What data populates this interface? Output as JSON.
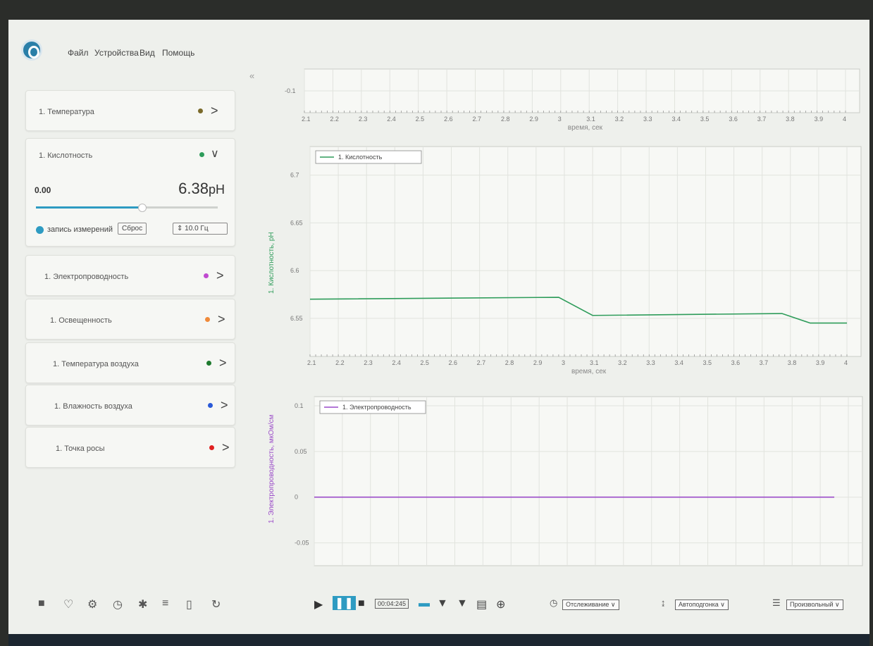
{
  "menu": [
    "Файл",
    "Устройства",
    "Вид",
    "Помощь"
  ],
  "collapse_glyph": "«",
  "sensors": [
    {
      "label": "1. Температура",
      "color": "#7a6a2a",
      "chevron": ">"
    },
    {
      "label": "1. Кислотность",
      "color": "#2e9c5a",
      "chevron": "∨"
    },
    {
      "label": "1. Электропроводность",
      "color": "#c04ad0",
      "chevron": ">"
    },
    {
      "label": "1. Освещенность",
      "color": "#f08a3a",
      "chevron": ">"
    },
    {
      "label": "1. Температура воздуха",
      "color": "#1e7a2e",
      "chevron": ">"
    },
    {
      "label": "1. Влажность воздуха",
      "color": "#2a5ad8",
      "chevron": ">"
    },
    {
      "label": "1. Точка росы",
      "color": "#e02020",
      "chevron": ">"
    }
  ],
  "expanded": {
    "min_value": "0.00",
    "value": "6.38",
    "unit": "pH",
    "slider_fraction": 0.58,
    "record_label": "запись измерений",
    "reset_label": "Сброс",
    "rate": "10.0",
    "rate_unit": "Гц"
  },
  "colors": {
    "accent": "#2e9bc2",
    "ph_line": "#2e9c5a",
    "cond_line": "#9a4ac8"
  },
  "chart_data": [
    {
      "type": "line",
      "xlabel": "время, сек",
      "x_ticks": [
        "2.1",
        "2.2",
        "2.3",
        "2.4",
        "2.5",
        "2.6",
        "2.7",
        "2.8",
        "2.9",
        "3",
        "3.1",
        "3.2",
        "3.3",
        "3.4",
        "3.5",
        "3.6",
        "3.7",
        "3.8",
        "3.9",
        "4"
      ],
      "y_ticks": [
        "-0.1"
      ],
      "xlim": [
        2.1,
        4.0
      ]
    },
    {
      "type": "line",
      "xlabel": "время, сек",
      "ylabel": "1. Кислотность, pH",
      "x_ticks": [
        "2.1",
        "2.2",
        "2.3",
        "2.4",
        "2.5",
        "2.6",
        "2.7",
        "2.8",
        "2.9",
        "3",
        "3.1",
        "3.2",
        "3.3",
        "3.4",
        "3.5",
        "3.6",
        "3.7",
        "3.8",
        "3.9",
        "4"
      ],
      "y_ticks": [
        "6.7",
        "6.65",
        "6.6",
        "6.55"
      ],
      "xlim": [
        2.1,
        4.0
      ],
      "ylim": [
        6.51,
        6.73
      ],
      "series": [
        {
          "name": "1. Кислотность",
          "x": [
            2.1,
            2.98,
            3.1,
            3.77,
            3.87,
            4.0
          ],
          "y": [
            6.57,
            6.572,
            6.553,
            6.555,
            6.545,
            6.545
          ]
        }
      ]
    },
    {
      "type": "line",
      "ylabel": "1. Электропроводность, мкОм/см",
      "y_ticks": [
        "0.1",
        "0.05",
        "0",
        "-0.05"
      ],
      "xlim": [
        2.1,
        4.0
      ],
      "ylim": [
        -0.075,
        0.11
      ],
      "series": [
        {
          "name": "1. Электропроводность",
          "x": [
            2.1,
            3.95
          ],
          "y": [
            0,
            0
          ]
        }
      ]
    }
  ],
  "toolbar": {
    "time": "00:04:245",
    "mode_label": "Отслеживание",
    "fit_label": "Автоподгонка",
    "view_label": "Произвольный"
  }
}
